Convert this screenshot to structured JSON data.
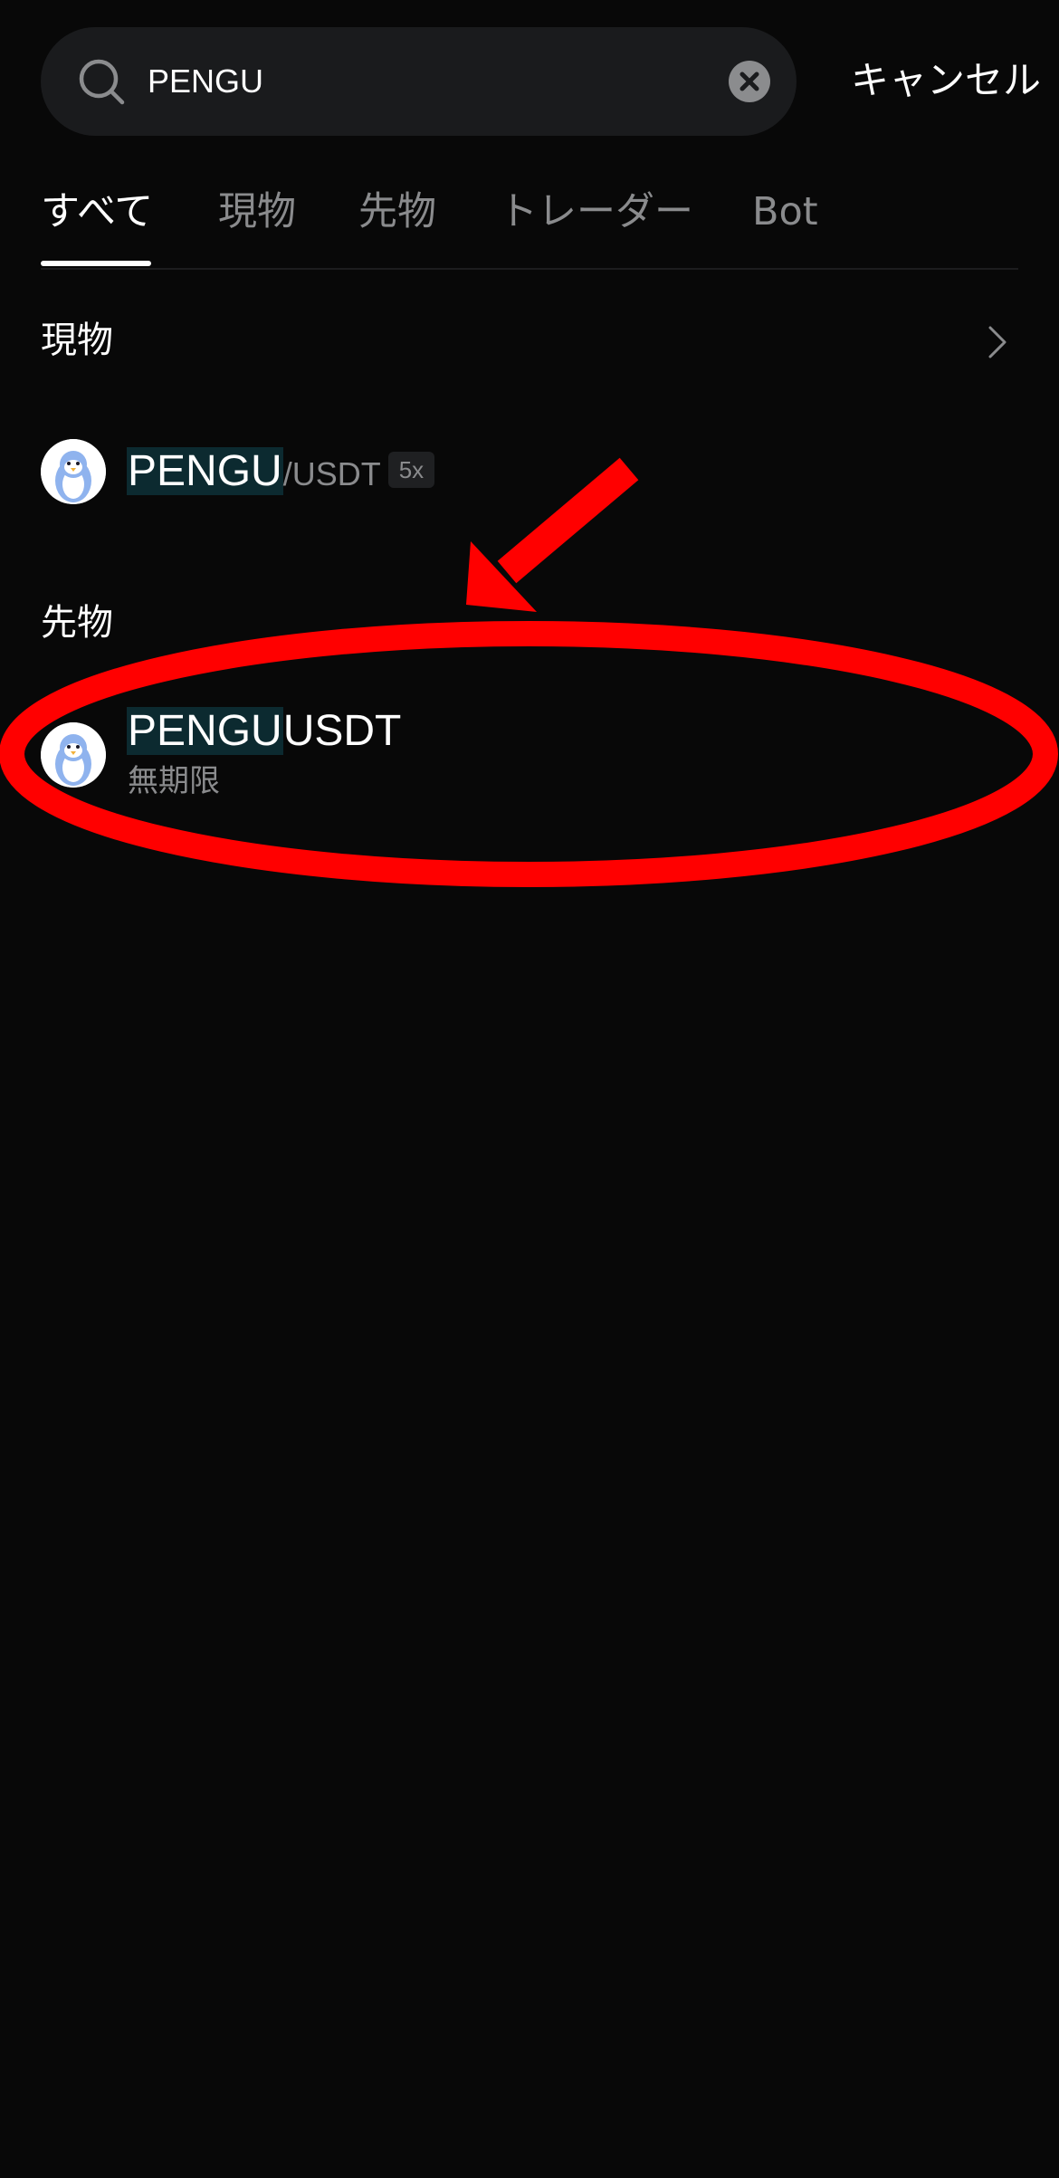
{
  "search": {
    "value": "PENGU",
    "cancel_label": "キャンセル"
  },
  "tabs": [
    {
      "label": "すべて",
      "active": true
    },
    {
      "label": "現物",
      "active": false
    },
    {
      "label": "先物",
      "active": false
    },
    {
      "label": "トレーダー",
      "active": false
    },
    {
      "label": "Bot",
      "active": false
    }
  ],
  "spot_section": {
    "title": "現物",
    "item": {
      "highlight": "PENGU",
      "rest": "/USDT",
      "leverage": "5x"
    }
  },
  "futures_section": {
    "title": "先物",
    "item": {
      "highlight": "PENGU",
      "rest": "USDT",
      "subtitle": "無期限"
    }
  },
  "colors": {
    "background": "#080808",
    "highlight": "#0c2a30",
    "annotation": "#ff0000",
    "muted_text": "#8a8b8d"
  },
  "icons": [
    "search-icon",
    "clear-icon",
    "chevron-right-icon",
    "penguin-avatar-icon"
  ]
}
